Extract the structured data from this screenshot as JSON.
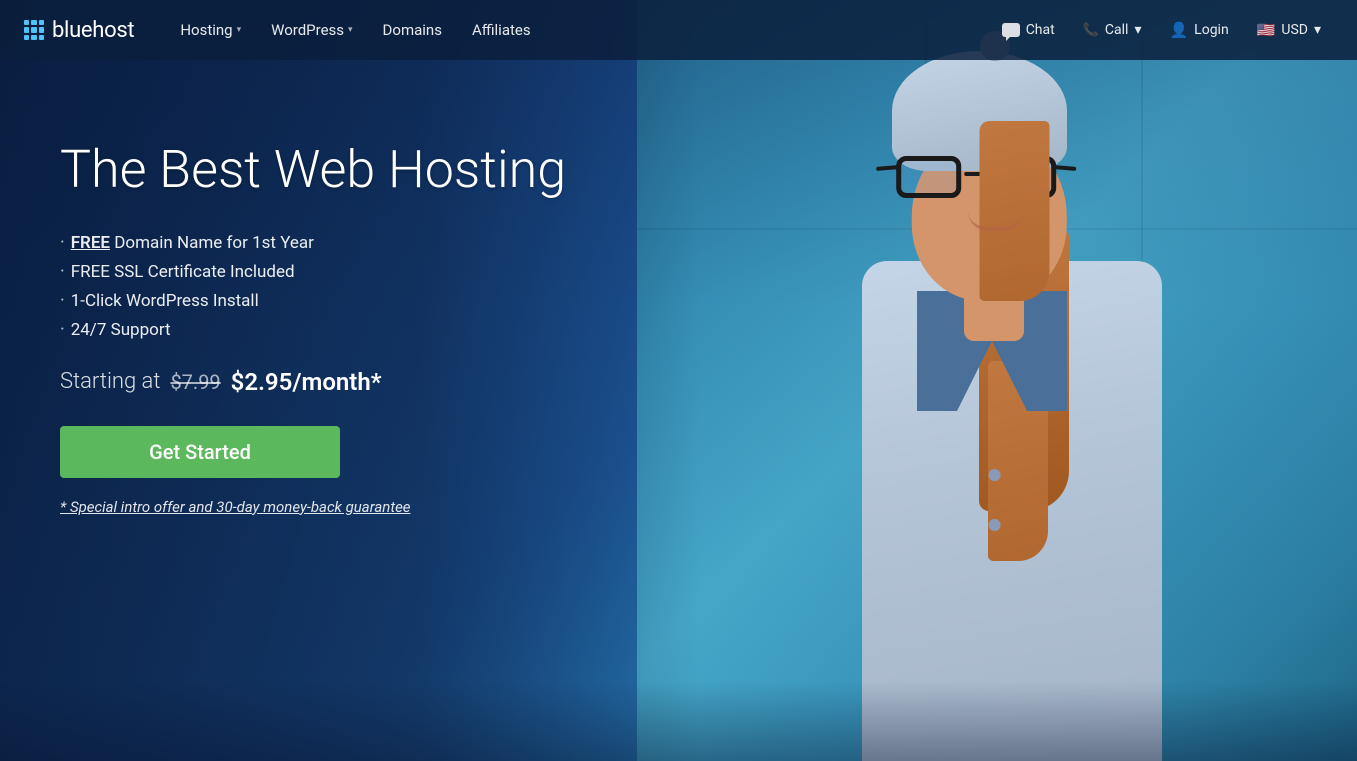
{
  "nav": {
    "brand": "bluehost",
    "links": [
      {
        "label": "Hosting",
        "has_dropdown": true
      },
      {
        "label": "WordPress",
        "has_dropdown": true
      },
      {
        "label": "Domains",
        "has_dropdown": false
      },
      {
        "label": "Affiliates",
        "has_dropdown": false
      }
    ],
    "right": [
      {
        "label": "Chat",
        "icon": "chat-icon"
      },
      {
        "label": "Call",
        "icon": "phone-icon",
        "has_dropdown": true
      },
      {
        "label": "Login",
        "icon": "user-icon"
      },
      {
        "label": "USD",
        "icon": "flag-icon",
        "has_dropdown": true
      }
    ]
  },
  "hero": {
    "title": "The Best Web Hosting",
    "bullets": [
      {
        "text": "FREE Domain Name for 1st Year",
        "free_text": "FREE"
      },
      {
        "text": "FREE SSL Certificate Included"
      },
      {
        "text": "1-Click WordPress Install"
      },
      {
        "text": "24/7 Support"
      }
    ],
    "price_label": "Starting at",
    "price_old": "$7.99",
    "price_new": "$2.95/month*",
    "cta_label": "Get Started",
    "promo_text": "* Special intro offer and 30-day money-back guarantee"
  }
}
